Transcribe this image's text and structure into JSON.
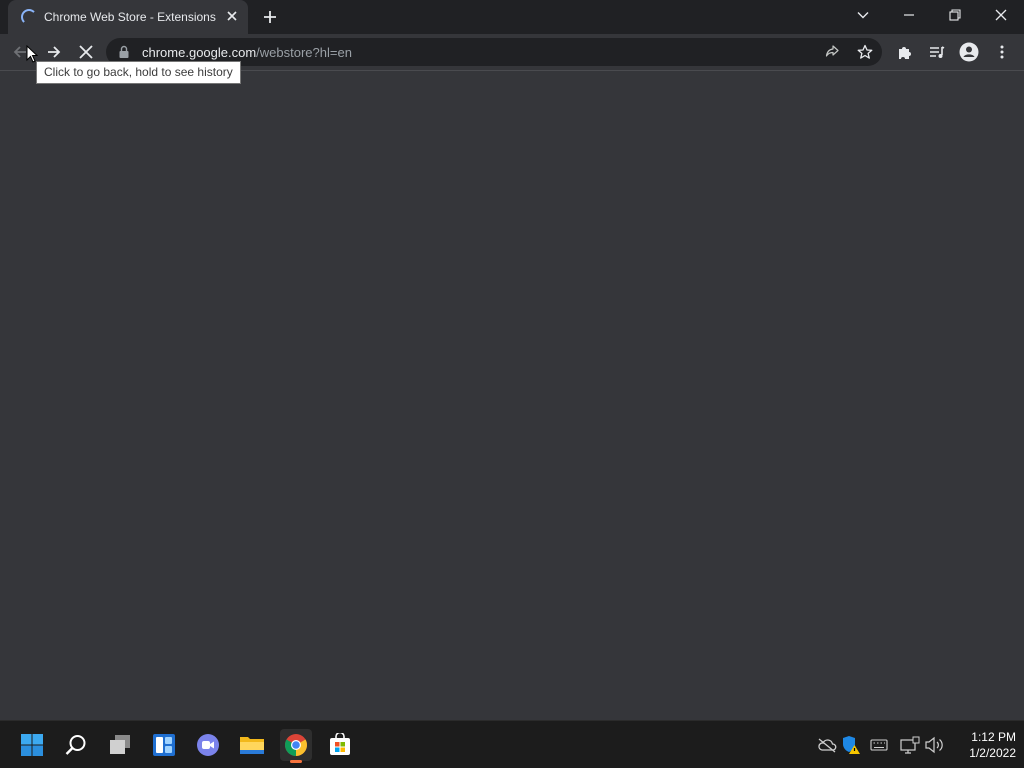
{
  "tab": {
    "title": "Chrome Web Store - Extensions",
    "loading": true
  },
  "omnibox": {
    "url_host": "chrome.google.com",
    "url_path": "/webstore?hl=en"
  },
  "tooltip": {
    "text": "Click to go back, hold to see history"
  },
  "toolbar": {
    "reload_state": "stop"
  },
  "taskbar": {
    "apps": [
      {
        "name": "start-icon"
      },
      {
        "name": "search-icon"
      },
      {
        "name": "task-view-icon"
      },
      {
        "name": "widgets-icon"
      },
      {
        "name": "teams-chat-icon"
      },
      {
        "name": "file-explorer-icon"
      },
      {
        "name": "chrome-icon",
        "active": true
      },
      {
        "name": "store-icon"
      }
    ],
    "tray": [
      "onedrive-offline-icon",
      "security-warning-icon",
      "keyboard-icon",
      "network-icon",
      "volume-icon"
    ],
    "time": "1:12 PM",
    "date": "1/2/2022"
  },
  "colors": {
    "page_background": "#35363a",
    "tabstrip": "#202124",
    "loading_spinner": "#8ab4f8",
    "taskbar": "#1c1c1c",
    "active_indicator": "#f7743e"
  }
}
